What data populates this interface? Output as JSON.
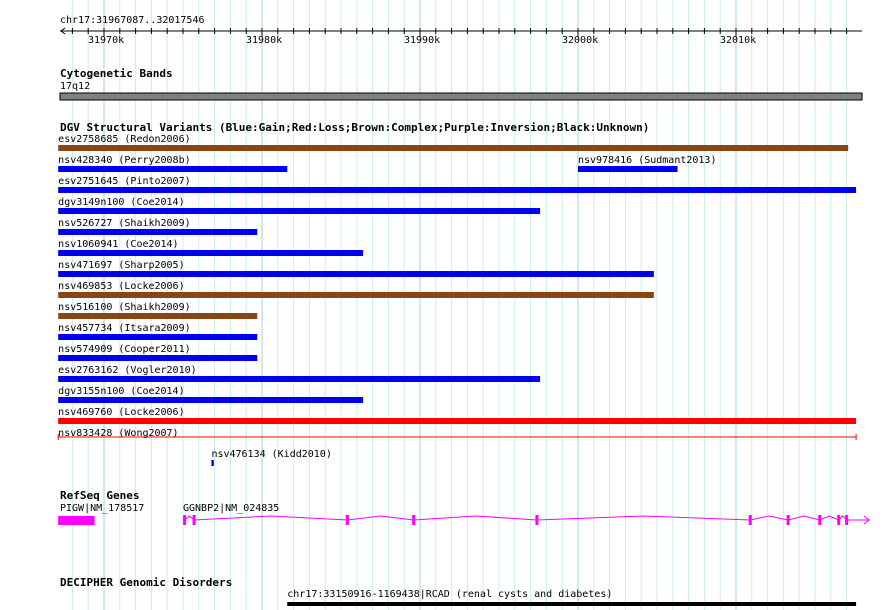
{
  "ruler": {
    "title": "chr17:31967087..32017546",
    "start_kb": 31967.087,
    "end_kb": 32017.546,
    "ticks": [
      "31970k",
      "31980k",
      "31990k",
      "32000k",
      "32010k"
    ],
    "tick_values": [
      31970,
      31980,
      31990,
      32000,
      32010
    ]
  },
  "cyto": {
    "title": "Cytogenetic Bands",
    "band": "17q12",
    "color": "#808080"
  },
  "dgv": {
    "title": "DGV Structural Variants (Blue:Gain;Red:Loss;Brown:Complex;Purple:Inversion;Black:Unknown)",
    "colors": {
      "gain": "#0000ee",
      "loss": "#ff0000",
      "complex": "#8b4513"
    },
    "variants": [
      {
        "label": "esv2758685 (Redon2006)",
        "type": "complex",
        "start": 31967.1,
        "end": 32017.1,
        "row": 0
      },
      {
        "label": "nsv428340 (Perry2008b)",
        "type": "gain",
        "start": 31967.1,
        "end": 31981.6,
        "row": 1
      },
      {
        "label": "nsv978416 (Sudmant2013)",
        "type": "gain",
        "start": 32000.0,
        "end": 32006.3,
        "row": 1
      },
      {
        "label": "esv2751645 (Pinto2007)",
        "type": "gain",
        "start": 31967.1,
        "end": 32017.6,
        "row": 2
      },
      {
        "label": "dgv3149n100 (Coe2014)",
        "type": "gain",
        "start": 31967.1,
        "end": 31997.6,
        "row": 3
      },
      {
        "label": "nsv526727 (Shaikh2009)",
        "type": "gain",
        "start": 31967.1,
        "end": 31979.7,
        "row": 4
      },
      {
        "label": "nsv1060941 (Coe2014)",
        "type": "gain",
        "start": 31967.1,
        "end": 31986.4,
        "row": 5
      },
      {
        "label": "nsv471697 (Sharp2005)",
        "type": "gain",
        "start": 31967.1,
        "end": 32004.8,
        "row": 6
      },
      {
        "label": "nsv469853 (Locke2006)",
        "type": "complex",
        "start": 31967.1,
        "end": 32004.8,
        "row": 7
      },
      {
        "label": "nsv516100 (Shaikh2009)",
        "type": "complex",
        "start": 31967.1,
        "end": 31979.7,
        "row": 8
      },
      {
        "label": "nsv457734 (Itsara2009)",
        "type": "gain",
        "start": 31967.1,
        "end": 31979.7,
        "row": 9
      },
      {
        "label": "nsv574909 (Cooper2011)",
        "type": "gain",
        "start": 31967.1,
        "end": 31979.7,
        "row": 10
      },
      {
        "label": "esv2763162 (Vogler2010)",
        "type": "gain",
        "start": 31967.1,
        "end": 31997.6,
        "row": 11
      },
      {
        "label": "dgv3155n100 (Coe2014)",
        "type": "gain",
        "start": 31967.1,
        "end": 31986.4,
        "row": 12
      },
      {
        "label": "nsv469760 (Locke2006)",
        "type": "loss",
        "start": 31967.1,
        "end": 32017.6,
        "row": 13
      },
      {
        "label": "nsv833428 (Wong2007)",
        "type": "loss",
        "start": 31967.1,
        "end": 32017.6,
        "row": 14,
        "thin": true
      },
      {
        "label": "nsv476134 (Kidd2010)",
        "type": "gain",
        "start": 31976.8,
        "end": 31976.95,
        "row": 15
      }
    ]
  },
  "refseq": {
    "title": "RefSeq Genes",
    "color": "#ff00ff",
    "genes": [
      {
        "label": "PIGW|NM_178517",
        "start": 31967.1,
        "end": 31969.4
      },
      {
        "label": "GGNBP2|NM_024835",
        "start": 31975.1,
        "end": 32018.2,
        "exons": [
          31975.1,
          31975.7,
          31985.4,
          31989.6,
          31997.4,
          32010.9,
          32013.3,
          32015.3,
          32016.5,
          32017.0
        ]
      }
    ]
  },
  "decipher": {
    "title": "DECIPHER Genomic Disorders",
    "items": [
      {
        "label": "chr17:33150916-1169438|RCAD (renal cysts and diabetes)",
        "start": 31981.6,
        "end": 32017.6
      }
    ]
  }
}
